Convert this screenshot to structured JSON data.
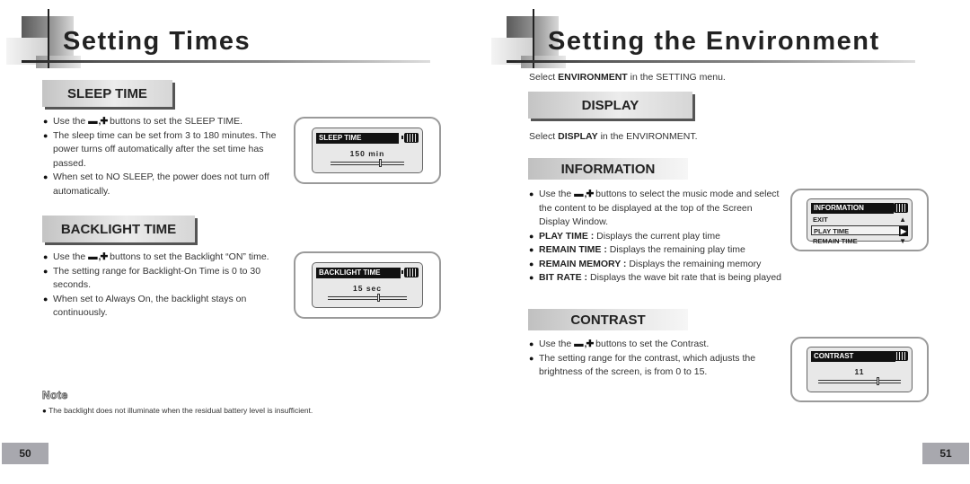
{
  "left_page": {
    "title": "Setting Times",
    "sleep_time": {
      "heading": "SLEEP TIME",
      "bullets": [
        {
          "pre": "Use the ",
          "buttons": "▬ ,✚",
          "post": " buttons to set the SLEEP TIME."
        },
        {
          "text": "The sleep time can be set from 3 to 180 minutes. The power turns off automatically after the set time has passed."
        },
        {
          "text": "When set to NO SLEEP, the power does not turn off automatically."
        }
      ],
      "screen": {
        "header": "SLEEP TIME",
        "value": "150  min",
        "slider_fraction": 0.68
      }
    },
    "backlight_time": {
      "heading": "BACKLIGHT TIME",
      "bullets": [
        {
          "pre": "Use the ",
          "buttons": "▬ ,✚",
          "post": " buttons to set the Backlight “ON” time."
        },
        {
          "text": "The setting range for Backlight-On Time is 0 to 30 seconds."
        },
        {
          "text": "When set to Always On, the backlight stays on continuously."
        }
      ],
      "screen": {
        "header": "BACKLIGHT TIME",
        "value": "15  sec",
        "slider_fraction": 0.65
      }
    },
    "note": {
      "title": "Note",
      "text": "The backlight does not illuminate when the residual battery level is insufficient."
    },
    "page_number": "50"
  },
  "right_page": {
    "title": "Setting the Environment",
    "intro": {
      "pre": "Select ",
      "bold": "ENVIRONMENT",
      "post": " in the SETTING menu."
    },
    "display": {
      "heading": "DISPLAY",
      "intro": {
        "pre": "Select ",
        "bold": "DISPLAY",
        "post": " in the ENVIRONMENT."
      }
    },
    "information": {
      "heading": "INFORMATION",
      "bullets": [
        {
          "pre": "Use the ",
          "buttons": "▬ ,✚",
          "post": " buttons to select the music mode and select the content to be displayed at the top of the Screen Display Window."
        },
        {
          "bold": "PLAY TIME :",
          "text": " Displays the current play time"
        },
        {
          "bold": "REMAIN TIME :",
          "text": " Displays the remaining play time"
        },
        {
          "bold": "REMAIN MEMORY :",
          "text": " Displays the remaining memory"
        },
        {
          "bold": "BIT RATE :",
          "text": " Displays the wave bit rate that is being played"
        }
      ],
      "screen": {
        "header": "INFORMATION",
        "items": [
          {
            "label": "EXIT",
            "arrow": "▲"
          },
          {
            "label": "PLAY TIME",
            "arrow": "▶",
            "selected": true
          },
          {
            "label": "REMAIN TIME",
            "arrow": "▼"
          }
        ]
      }
    },
    "contrast": {
      "heading": "CONTRAST",
      "bullets": [
        {
          "pre": "Use the ",
          "buttons": "▬ ,✚",
          "post": " buttons to set the Contrast."
        },
        {
          "text": "The setting range for the contrast, which adjusts the brightness of the screen, is from 0 to 15."
        }
      ],
      "screen": {
        "header": "CONTRAST",
        "value": "11",
        "slider_fraction": 0.73
      }
    },
    "page_number": "51"
  }
}
